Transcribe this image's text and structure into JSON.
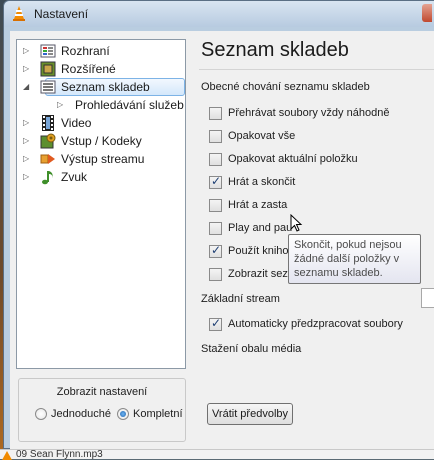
{
  "window": {
    "title": "Nastavení"
  },
  "tree": {
    "items": [
      {
        "label": "Rozhraní",
        "icon": "interface-icon",
        "arrow": "▷",
        "level": 0,
        "selected": false
      },
      {
        "label": "Rozšířené",
        "icon": "chip-icon",
        "arrow": "▷",
        "level": 0,
        "selected": false
      },
      {
        "label": "Seznam skladeb",
        "icon": "playlist-icon",
        "arrow": "◢",
        "level": 0,
        "selected": true
      },
      {
        "label": "Prohledávání služeb",
        "icon": "",
        "arrow": "▷",
        "level": 1,
        "selected": false
      },
      {
        "label": "Video",
        "icon": "film-icon",
        "arrow": "▷",
        "level": 0,
        "selected": false
      },
      {
        "label": "Vstup / Kodeky",
        "icon": "codec-icon",
        "arrow": "▷",
        "level": 0,
        "selected": false
      },
      {
        "label": "Výstup streamu",
        "icon": "stream-output-icon",
        "arrow": "▷",
        "level": 0,
        "selected": false
      },
      {
        "label": "Zvuk",
        "icon": "music-note-icon",
        "arrow": "▷",
        "level": 0,
        "selected": false
      }
    ]
  },
  "show_settings": {
    "title": "Zobrazit nastavení",
    "options": [
      {
        "label": "Jednoduché",
        "checked": false
      },
      {
        "label": "Kompletní",
        "checked": true
      }
    ]
  },
  "panel": {
    "title": "Seznam skladeb",
    "section_label": "Obecné chování seznamu skladeb",
    "checkboxes": [
      {
        "label": "Přehrávat soubory vždy náhodně",
        "checked": false
      },
      {
        "label": "Opakovat vše",
        "checked": false
      },
      {
        "label": "Opakovat aktuální položku",
        "checked": false
      },
      {
        "label": "Hrát a skončit",
        "checked": true
      },
      {
        "label": "Hrát a zasta",
        "checked": false
      },
      {
        "label": "Play and pau",
        "checked": false
      },
      {
        "label": "Použít knihovnu médií",
        "checked": true
      },
      {
        "label": "Zobrazit seznam skladeb jako strom",
        "checked": false
      }
    ],
    "default_stream_label": "Základní stream",
    "preparse": {
      "label": "Automaticky předzpracovat soubory",
      "checked": true
    },
    "cover_label": "Stažení obalu média",
    "reset_button": "Vrátit předvolby"
  },
  "tooltip": {
    "text": "Skončit, pokud nejsou žádné další položky v seznamu skladeb."
  },
  "background": {
    "file_label": "09 Sean Flynn.mp3"
  },
  "colors": {
    "selection": "#d4e8fb",
    "accent": "#1f64b0"
  }
}
